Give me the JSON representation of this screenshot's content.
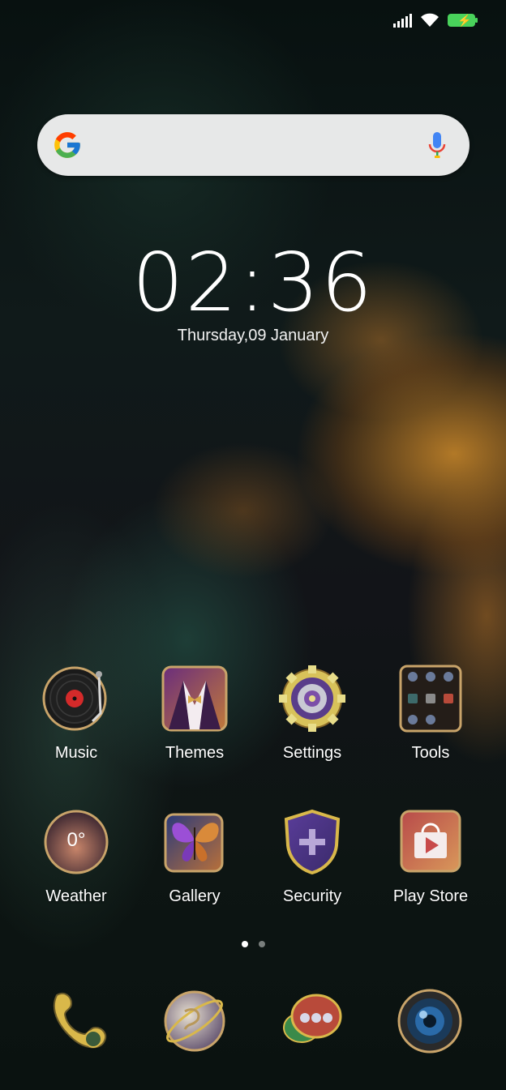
{
  "status_bar": {
    "signal_icon": "cellular-signal-icon",
    "wifi_icon": "wifi-icon",
    "battery_icon": "battery-charging-icon",
    "battery_color": "#49d25b"
  },
  "search": {
    "placeholder": "",
    "logo_icon": "google-g-icon",
    "mic_icon": "microphone-icon"
  },
  "clock": {
    "time": "02:36",
    "date": "Thursday,09 January"
  },
  "apps": [
    {
      "label": "Music",
      "icon": "vinyl-record-icon"
    },
    {
      "label": "Themes",
      "icon": "tuxedo-icon"
    },
    {
      "label": "Settings",
      "icon": "gear-icon"
    },
    {
      "label": "Tools",
      "icon": "folder-icon"
    },
    {
      "label": "Weather",
      "icon": "weather-icon",
      "temperature": "0°"
    },
    {
      "label": "Gallery",
      "icon": "butterfly-icon"
    },
    {
      "label": "Security",
      "icon": "shield-icon"
    },
    {
      "label": "Play Store",
      "icon": "shopping-bag-icon"
    }
  ],
  "page_indicator": {
    "pages": 2,
    "active": 1
  },
  "dock": [
    {
      "icon": "phone-icon"
    },
    {
      "icon": "browser-globe-icon"
    },
    {
      "icon": "messages-icon"
    },
    {
      "icon": "camera-icon"
    }
  ]
}
